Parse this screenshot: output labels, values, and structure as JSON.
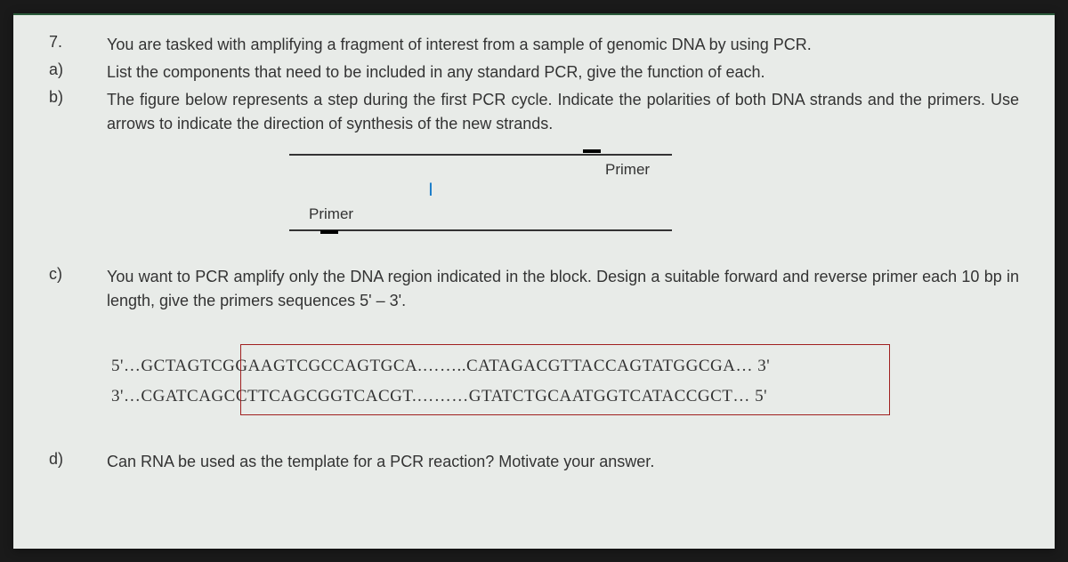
{
  "question": {
    "number": "7.",
    "intro": "You are tasked with amplifying a fragment of interest from a sample of genomic DNA by using PCR.",
    "parts": {
      "a": {
        "label": "a)",
        "text": "List the components that need to be included in any standard PCR, give the function of each."
      },
      "b": {
        "label": "b)",
        "text": "The figure below represents a step during the first PCR cycle.  Indicate the polarities of both DNA strands and the primers.  Use arrows to indicate the direction of synthesis of the new strands."
      },
      "c": {
        "label": "c)",
        "text": "You want to PCR amplify only the DNA region indicated in the block.  Design a suitable forward and reverse primer each 10 bp in length, give the primers sequences 5' – 3'."
      },
      "d": {
        "label": "d)",
        "text": "Can RNA be used as the template for a PCR reaction? Motivate your answer."
      }
    }
  },
  "figure": {
    "primer_label_top": "Primer",
    "primer_label_bottom": "Primer",
    "cursor_glyph": "Ⅰ"
  },
  "sequences": {
    "line1": "5'…GCTAGTCGGAAGTCGCCAGTGCA.……..CATAGACGTTACCAGTATGGCGA… 3'",
    "line2": "3'…CGATCAGCCTTCAGCGGTCACGT.………GTATCTGCAATGGTCATACCGCT… 5'"
  }
}
